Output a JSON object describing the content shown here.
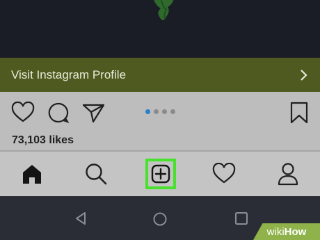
{
  "banner": {
    "label": "Visit Instagram Profile"
  },
  "post": {
    "likes": "73,103 likes",
    "carousel": {
      "count": 4,
      "active": 0
    }
  },
  "icons": {
    "actions": [
      "heart-outline-icon",
      "comment-bubble-icon",
      "send-paper-plane-icon",
      "bookmark-icon"
    ],
    "tabs": [
      "home-icon",
      "search-icon",
      "new-post-plus-icon",
      "activity-heart-icon",
      "profile-person-icon"
    ],
    "system_nav": [
      "back-triangle-icon",
      "home-circle-icon",
      "recents-square-icon"
    ]
  },
  "colors": {
    "banner_bg": "#4f5a21",
    "highlight": "#47e22c",
    "carousel_active": "#2a7fc5",
    "watermark_bg": "#8fb34a"
  },
  "watermark": {
    "wiki": "wiki",
    "how": "How"
  }
}
